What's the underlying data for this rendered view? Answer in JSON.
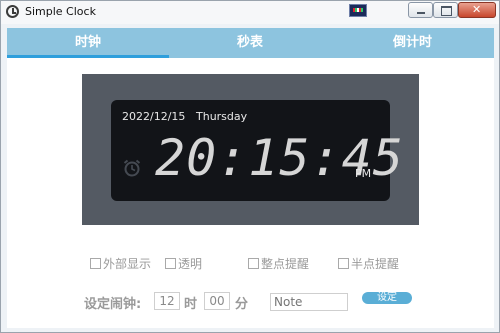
{
  "window": {
    "title": "Simple Clock"
  },
  "tabs": [
    {
      "label": "时钟",
      "active": true
    },
    {
      "label": "秒表",
      "active": false
    },
    {
      "label": "倒计时",
      "active": false
    }
  ],
  "clock": {
    "date": "2022/12/15",
    "weekday": "Thursday",
    "time": "20:15:45",
    "ampm": "PM"
  },
  "options": [
    {
      "label": "外部显示",
      "checked": false
    },
    {
      "label": "透明",
      "checked": false
    },
    {
      "label": "整点提醒",
      "checked": false
    },
    {
      "label": "半点提醒",
      "checked": false
    }
  ],
  "alarm": {
    "label": "设定闹钟:",
    "hour_value": "12",
    "hour_unit": "时",
    "minute_value": "00",
    "minute_unit": "分",
    "note_placeholder": "Note",
    "set_label": "设定"
  },
  "colors": {
    "tab_bar": "#8dc4df",
    "tab_active_underline": "#2e9fdc",
    "clock_panel": "#545a63",
    "clock_face": "#121418",
    "set_button": "#5aaed6"
  }
}
